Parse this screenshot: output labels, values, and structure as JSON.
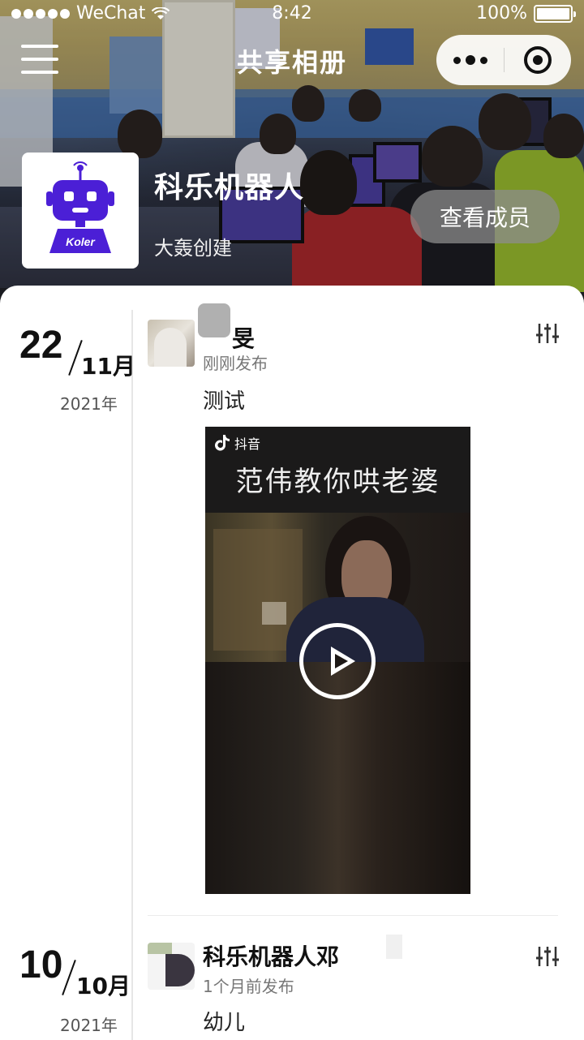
{
  "status_bar": {
    "carrier": "WeChat",
    "time": "8:42",
    "battery": "100%"
  },
  "nav": {
    "title": "共享相册"
  },
  "album": {
    "logo_text": "Koler",
    "name": "科乐机器人",
    "creator": "大轰创建",
    "members_button": "查看成员"
  },
  "posts": [
    {
      "day": "22",
      "month": "11月",
      "year": "2021年",
      "author": "旻",
      "time_ago": "刚刚发布",
      "text": "测试",
      "video": {
        "app_label": "抖音",
        "headline": "范伟教你哄老婆"
      }
    },
    {
      "day": "10",
      "month": "10月",
      "year": "2021年",
      "author": "科乐机器人邓",
      "time_ago": "1个月前发布",
      "text": "幼儿"
    }
  ],
  "colors": {
    "accent": "#4b1fd6",
    "members_button_bg": "#8c8c8c"
  }
}
